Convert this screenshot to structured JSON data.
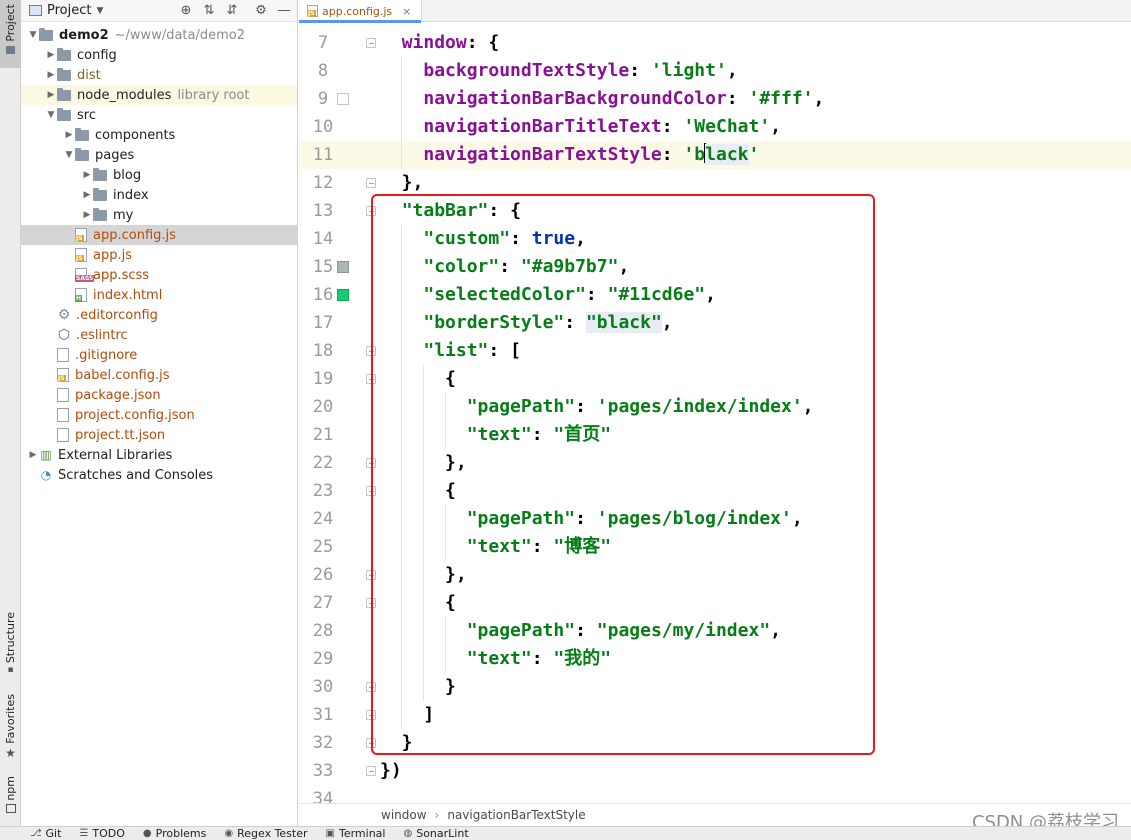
{
  "left_strip": {
    "project_tab": "Project",
    "structure_tab": "Structure",
    "favorites_tab": "Favorites",
    "npm_tab": "npm"
  },
  "project_panel": {
    "title": "Project",
    "tools": {
      "locate_icon": "⊕",
      "expand_icon": "⇅",
      "collapse_icon": "⇵",
      "settings_icon": "⚙",
      "hide_icon": "—"
    },
    "tree": [
      {
        "label": "demo2",
        "hint": "~/www/data/demo2",
        "depth": 0,
        "kind": "folder",
        "expanded": true,
        "style": "root"
      },
      {
        "label": "config",
        "depth": 1,
        "kind": "folder",
        "expanded": false
      },
      {
        "label": "dist",
        "depth": 1,
        "kind": "folder",
        "expanded": false,
        "style": "ignored"
      },
      {
        "label": "node_modules",
        "hint": "library root",
        "depth": 1,
        "kind": "folder",
        "expanded": false,
        "row": "highlight"
      },
      {
        "label": "src",
        "depth": 1,
        "kind": "folder",
        "expanded": true
      },
      {
        "label": "components",
        "depth": 2,
        "kind": "folder",
        "expanded": false
      },
      {
        "label": "pages",
        "depth": 2,
        "kind": "folder",
        "expanded": true
      },
      {
        "label": "blog",
        "depth": 3,
        "kind": "folder",
        "expanded": false
      },
      {
        "label": "index",
        "depth": 3,
        "kind": "folder",
        "expanded": false
      },
      {
        "label": "my",
        "depth": 3,
        "kind": "folder",
        "expanded": false
      },
      {
        "label": "app.config.js",
        "depth": 2,
        "kind": "js",
        "style": "modified",
        "row": "selected"
      },
      {
        "label": "app.js",
        "depth": 2,
        "kind": "js",
        "style": "modified"
      },
      {
        "label": "app.scss",
        "depth": 2,
        "kind": "sass",
        "style": "modified"
      },
      {
        "label": "index.html",
        "depth": 2,
        "kind": "html",
        "style": "modified"
      },
      {
        "label": ".editorconfig",
        "depth": 1,
        "kind": "gear",
        "style": "modified"
      },
      {
        "label": ".eslintrc",
        "depth": 1,
        "kind": "eslint",
        "style": "modified"
      },
      {
        "label": ".gitignore",
        "depth": 1,
        "kind": "plain",
        "style": "modified"
      },
      {
        "label": "babel.config.js",
        "depth": 1,
        "kind": "js",
        "style": "modified"
      },
      {
        "label": "package.json",
        "depth": 1,
        "kind": "plain",
        "style": "modified"
      },
      {
        "label": "project.config.json",
        "depth": 1,
        "kind": "plain",
        "style": "modified"
      },
      {
        "label": "project.tt.json",
        "depth": 1,
        "kind": "plain",
        "style": "modified"
      },
      {
        "label": "External Libraries",
        "depth": 0,
        "kind": "libs",
        "expanded": false
      },
      {
        "label": "Scratches and Consoles",
        "depth": 0,
        "kind": "scratch"
      }
    ]
  },
  "editor": {
    "tab_label": "app.config.js",
    "tab_badge": "JS",
    "close_icon": "×",
    "lines": [
      {
        "n": "7",
        "tokens": [
          [
            "pun",
            "  "
          ],
          [
            "prop",
            "window"
          ],
          [
            "pun",
            ": {"
          ]
        ],
        "fold": true
      },
      {
        "n": "8",
        "tokens": [
          [
            "pun",
            "    "
          ],
          [
            "prop",
            "backgroundTextStyle"
          ],
          [
            "pun",
            ": "
          ],
          [
            "str",
            "'light'"
          ],
          [
            "pun",
            ","
          ]
        ]
      },
      {
        "n": "9",
        "tokens": [
          [
            "pun",
            "    "
          ],
          [
            "prop",
            "navigationBarBackgroundColor"
          ],
          [
            "pun",
            ": "
          ],
          [
            "str",
            "'#fff'"
          ],
          [
            "pun",
            ","
          ]
        ],
        "mark": "white"
      },
      {
        "n": "10",
        "tokens": [
          [
            "pun",
            "    "
          ],
          [
            "prop",
            "navigationBarTitleText"
          ],
          [
            "pun",
            ": "
          ],
          [
            "str",
            "'WeChat'"
          ],
          [
            "pun",
            ","
          ]
        ]
      },
      {
        "n": "11",
        "tokens": [
          [
            "pun",
            "    "
          ],
          [
            "prop",
            "navigationBarTextStyle"
          ],
          [
            "pun",
            ": "
          ],
          [
            "str",
            "'b"
          ],
          [
            "cursor",
            ""
          ],
          [
            "strshade",
            "lack"
          ],
          [
            "str",
            "'"
          ]
        ],
        "current": true
      },
      {
        "n": "12",
        "tokens": [
          [
            "pun",
            "  },"
          ]
        ],
        "fold": true
      },
      {
        "n": "13",
        "tokens": [
          [
            "pun",
            "  "
          ],
          [
            "str",
            "\"tabBar\""
          ],
          [
            "pun",
            ": {"
          ]
        ],
        "fold": true
      },
      {
        "n": "14",
        "tokens": [
          [
            "pun",
            "    "
          ],
          [
            "str",
            "\"custom\""
          ],
          [
            "pun",
            ": "
          ],
          [
            "kw",
            "true"
          ],
          [
            "pun",
            ","
          ]
        ]
      },
      {
        "n": "15",
        "tokens": [
          [
            "pun",
            "    "
          ],
          [
            "str",
            "\"color\""
          ],
          [
            "pun",
            ": "
          ],
          [
            "str",
            "\"#a9b7b7\""
          ],
          [
            "pun",
            ","
          ]
        ],
        "mark": "grey"
      },
      {
        "n": "16",
        "tokens": [
          [
            "pun",
            "    "
          ],
          [
            "str",
            "\"selectedColor\""
          ],
          [
            "pun",
            ": "
          ],
          [
            "str",
            "\"#11cd6e\""
          ],
          [
            "pun",
            ","
          ]
        ],
        "mark": "green"
      },
      {
        "n": "17",
        "tokens": [
          [
            "pun",
            "    "
          ],
          [
            "str",
            "\"borderStyle\""
          ],
          [
            "pun",
            ": "
          ],
          [
            "strshade",
            "\"black\""
          ],
          [
            "pun",
            ","
          ]
        ]
      },
      {
        "n": "18",
        "tokens": [
          [
            "pun",
            "    "
          ],
          [
            "str",
            "\"list\""
          ],
          [
            "pun",
            ": ["
          ]
        ],
        "fold": true
      },
      {
        "n": "19",
        "tokens": [
          [
            "pun",
            "      {"
          ]
        ],
        "fold": true
      },
      {
        "n": "20",
        "tokens": [
          [
            "pun",
            "        "
          ],
          [
            "str",
            "\"pagePath\""
          ],
          [
            "pun",
            ": "
          ],
          [
            "str",
            "'pages/index/index'"
          ],
          [
            "pun",
            ","
          ]
        ]
      },
      {
        "n": "21",
        "tokens": [
          [
            "pun",
            "        "
          ],
          [
            "str",
            "\"text\""
          ],
          [
            "pun",
            ": "
          ],
          [
            "str",
            "\"首页\""
          ]
        ]
      },
      {
        "n": "22",
        "tokens": [
          [
            "pun",
            "      },"
          ]
        ],
        "fold": true
      },
      {
        "n": "23",
        "tokens": [
          [
            "pun",
            "      {"
          ]
        ],
        "fold": true
      },
      {
        "n": "24",
        "tokens": [
          [
            "pun",
            "        "
          ],
          [
            "str",
            "\"pagePath\""
          ],
          [
            "pun",
            ": "
          ],
          [
            "str",
            "'pages/blog/index'"
          ],
          [
            "pun",
            ","
          ]
        ]
      },
      {
        "n": "25",
        "tokens": [
          [
            "pun",
            "        "
          ],
          [
            "str",
            "\"text\""
          ],
          [
            "pun",
            ": "
          ],
          [
            "str",
            "\"博客\""
          ]
        ]
      },
      {
        "n": "26",
        "tokens": [
          [
            "pun",
            "      },"
          ]
        ],
        "fold": true
      },
      {
        "n": "27",
        "tokens": [
          [
            "pun",
            "      {"
          ]
        ],
        "fold": true
      },
      {
        "n": "28",
        "tokens": [
          [
            "pun",
            "        "
          ],
          [
            "str",
            "\"pagePath\""
          ],
          [
            "pun",
            ": "
          ],
          [
            "str",
            "\"pages/my/index\""
          ],
          [
            "pun",
            ","
          ]
        ]
      },
      {
        "n": "29",
        "tokens": [
          [
            "pun",
            "        "
          ],
          [
            "str",
            "\"text\""
          ],
          [
            "pun",
            ": "
          ],
          [
            "str",
            "\"我的\""
          ]
        ]
      },
      {
        "n": "30",
        "tokens": [
          [
            "pun",
            "      }"
          ]
        ],
        "fold": true
      },
      {
        "n": "31",
        "tokens": [
          [
            "pun",
            "    ]"
          ]
        ],
        "fold": true
      },
      {
        "n": "32",
        "tokens": [
          [
            "pun",
            "  }"
          ]
        ],
        "fold": true
      },
      {
        "n": "33",
        "tokens": [
          [
            "pun",
            "})"
          ]
        ],
        "fold": true
      },
      {
        "n": "34",
        "tokens": []
      }
    ],
    "breadcrumb": [
      "window",
      "navigationBarTextStyle"
    ]
  },
  "status_bar": [
    {
      "icon": "⎇",
      "label": "Git"
    },
    {
      "icon": "☰",
      "label": "TODO"
    },
    {
      "icon": "●",
      "label": "Problems"
    },
    {
      "icon": "◉",
      "label": "Regex Tester"
    },
    {
      "icon": "▣",
      "label": "Terminal"
    },
    {
      "icon": "◍",
      "label": "SonarLint"
    }
  ],
  "watermark": "CSDN @荔枝学习",
  "colors": {
    "property": "#871094",
    "string": "#067d17",
    "keyword": "#0033b3",
    "annotation_box": "#e21b1b",
    "swatch_grey": "#a9b7b7",
    "swatch_green": "#11cd6e"
  }
}
